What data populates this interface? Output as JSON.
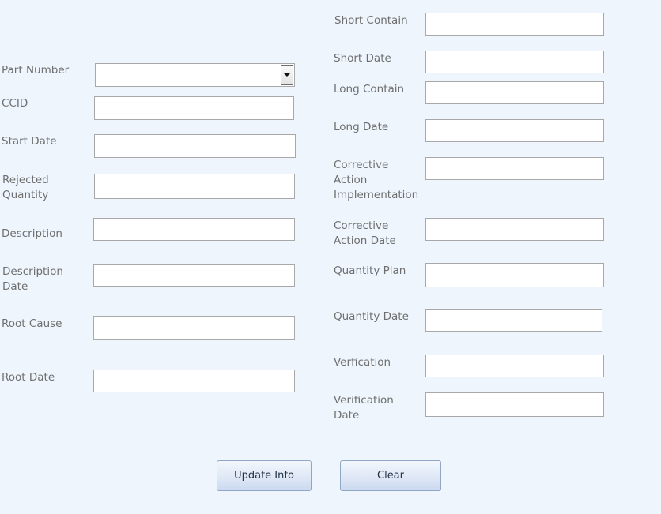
{
  "left": {
    "part_number": {
      "label": "Part Number",
      "value": ""
    },
    "ccid": {
      "label": "CCID",
      "value": ""
    },
    "start_date": {
      "label": "Start Date",
      "value": ""
    },
    "rejected_quantity": {
      "label": "Rejected\nQuantity",
      "value": ""
    },
    "description": {
      "label": "Description",
      "value": ""
    },
    "description_date": {
      "label": "Description\nDate",
      "value": ""
    },
    "root_cause": {
      "label": "Root Cause",
      "value": ""
    },
    "root_date": {
      "label": "Root Date",
      "value": ""
    }
  },
  "right": {
    "short_contain": {
      "label": "Short Contain",
      "value": ""
    },
    "short_date": {
      "label": "Short Date",
      "value": ""
    },
    "long_contain": {
      "label": "Long Contain",
      "value": ""
    },
    "long_date": {
      "label": "Long Date",
      "value": ""
    },
    "corrective_action_implementation": {
      "label": "Corrective\nAction\nImplementation",
      "value": ""
    },
    "corrective_action_date": {
      "label": "Corrective\nAction Date",
      "value": ""
    },
    "quantity_plan": {
      "label": "Quantity Plan",
      "value": ""
    },
    "quantity_date": {
      "label": "Quantity Date",
      "value": ""
    },
    "verfication": {
      "label": "Verfication",
      "value": ""
    },
    "verification_date": {
      "label": "Verification\nDate",
      "value": ""
    }
  },
  "buttons": {
    "update_label": "Update Info",
    "clear_label": "Clear"
  },
  "icons": {
    "dropdown": "chevron-down-icon"
  }
}
